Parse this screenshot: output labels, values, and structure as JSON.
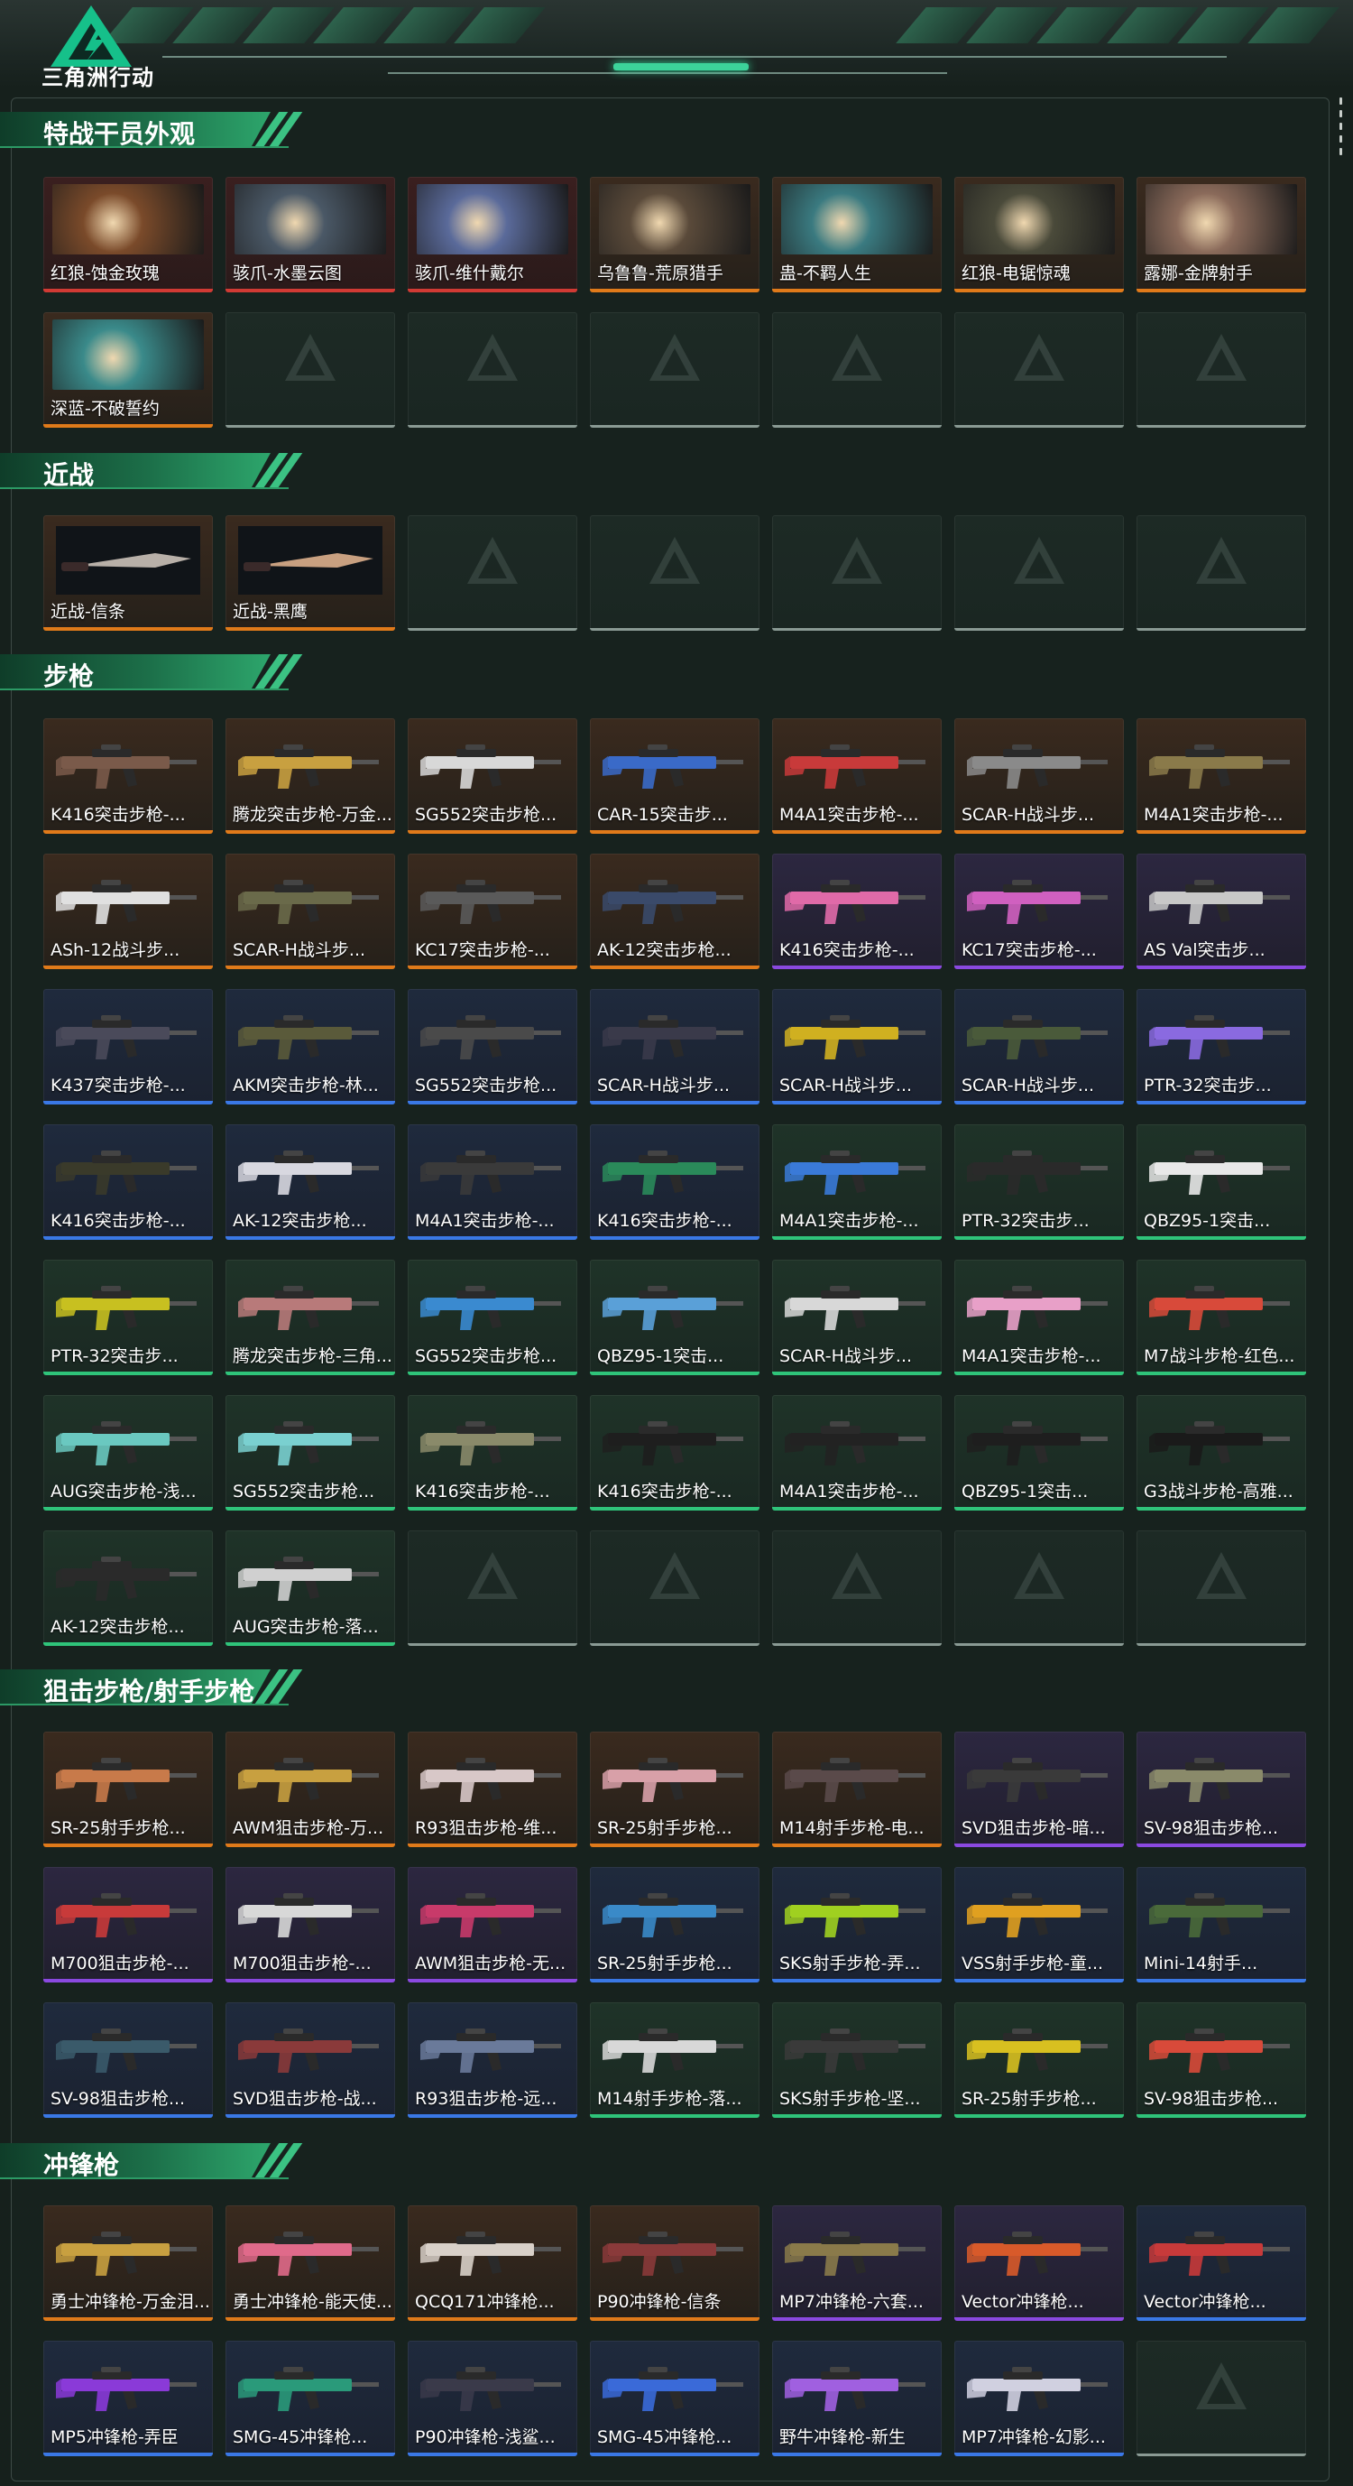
{
  "header": {
    "logo_text": "三角洲行动"
  },
  "colors": {
    "orange": "#e07a1a",
    "purple": "#8a49e0",
    "blue": "#3a78e6",
    "green": "#2fc47a",
    "red": "#d13a34",
    "accent": "#2da66c"
  },
  "sections": [
    {
      "title": "特战干员外观",
      "items": [
        {
          "label": "红狼-蚀金玫瑰",
          "rarity": "red",
          "kind": "portrait",
          "tint": "#7a4a2a"
        },
        {
          "label": "骇爪-水墨云图",
          "rarity": "red",
          "kind": "portrait",
          "tint": "#4a5866"
        },
        {
          "label": "骇爪-维什戴尔",
          "rarity": "red",
          "kind": "portrait",
          "tint": "#5a6a9a"
        },
        {
          "label": "乌鲁鲁-荒原猎手",
          "rarity": "orange",
          "kind": "portrait",
          "tint": "#5a4a3a"
        },
        {
          "label": "蛊-不羁人生",
          "rarity": "orange",
          "kind": "portrait",
          "tint": "#3a7a80"
        },
        {
          "label": "红狼-电锯惊魂",
          "rarity": "orange",
          "kind": "portrait",
          "tint": "#4a4a3a"
        },
        {
          "label": "露娜-金牌射手",
          "rarity": "orange",
          "kind": "portrait",
          "tint": "#8a6a5a"
        },
        {
          "label": "深蓝-不破誓约",
          "rarity": "orange",
          "kind": "portrait",
          "tint": "#3a8a8a"
        },
        {
          "label": "",
          "rarity": "empty"
        },
        {
          "label": "",
          "rarity": "empty"
        },
        {
          "label": "",
          "rarity": "empty"
        },
        {
          "label": "",
          "rarity": "empty"
        },
        {
          "label": "",
          "rarity": "empty"
        },
        {
          "label": "",
          "rarity": "empty"
        }
      ]
    },
    {
      "title": "近战",
      "items": [
        {
          "label": "近战-信条",
          "rarity": "orange",
          "kind": "knife",
          "tint": "#b8b0a8"
        },
        {
          "label": "近战-黑鹰",
          "rarity": "orange",
          "kind": "knife",
          "tint": "#c8a080"
        },
        {
          "label": "",
          "rarity": "empty"
        },
        {
          "label": "",
          "rarity": "empty"
        },
        {
          "label": "",
          "rarity": "empty"
        },
        {
          "label": "",
          "rarity": "empty"
        },
        {
          "label": "",
          "rarity": "empty"
        }
      ]
    },
    {
      "title": "步枪",
      "items": [
        {
          "label": "K416突击步枪-...",
          "rarity": "orange",
          "tint": "#7a5a4a"
        },
        {
          "label": "腾龙突击步枪-万金...",
          "rarity": "orange",
          "tint": "#c8a040"
        },
        {
          "label": "SG552突击步枪...",
          "rarity": "orange",
          "tint": "#d8d8d8"
        },
        {
          "label": "CAR-15突击步...",
          "rarity": "orange",
          "tint": "#3a6ac8"
        },
        {
          "label": "M4A1突击步枪-...",
          "rarity": "orange",
          "tint": "#c83a3a"
        },
        {
          "label": "SCAR-H战斗步...",
          "rarity": "orange",
          "tint": "#8a8a8a"
        },
        {
          "label": "M4A1突击步枪-...",
          "rarity": "orange",
          "tint": "#8a7a4a"
        },
        {
          "label": "ASh-12战斗步...",
          "rarity": "orange",
          "tint": "#e0e0e0"
        },
        {
          "label": "SCAR-H战斗步...",
          "rarity": "orange",
          "tint": "#6a6a4a"
        },
        {
          "label": "KC17突击步枪-...",
          "rarity": "orange",
          "tint": "#5a5a5a"
        },
        {
          "label": "AK-12突击步枪...",
          "rarity": "orange",
          "tint": "#3a4a6a"
        },
        {
          "label": "K416突击步枪-...",
          "rarity": "purple",
          "tint": "#e06aa8"
        },
        {
          "label": "KC17突击步枪-...",
          "rarity": "purple",
          "tint": "#d060c0"
        },
        {
          "label": "AS Val突击步...",
          "rarity": "purple",
          "tint": "#c8c8c8"
        },
        {
          "label": "K437突击步枪-...",
          "rarity": "blue",
          "tint": "#4a4a5a"
        },
        {
          "label": "AKM突击步枪-林...",
          "rarity": "blue",
          "tint": "#5a5a3a"
        },
        {
          "label": "SG552突击步枪...",
          "rarity": "blue",
          "tint": "#4a4a4a"
        },
        {
          "label": "SCAR-H战斗步...",
          "rarity": "blue",
          "tint": "#3a3a4a"
        },
        {
          "label": "SCAR-H战斗步...",
          "rarity": "blue",
          "tint": "#d0b020"
        },
        {
          "label": "SCAR-H战斗步...",
          "rarity": "blue",
          "tint": "#4a5a3a"
        },
        {
          "label": "PTR-32突击步...",
          "rarity": "blue",
          "tint": "#8a6ae0"
        },
        {
          "label": "K416突击步枪-...",
          "rarity": "blue",
          "tint": "#3a3a2a"
        },
        {
          "label": "AK-12突击步枪...",
          "rarity": "blue",
          "tint": "#d8d8e0"
        },
        {
          "label": "M4A1突击步枪-...",
          "rarity": "blue",
          "tint": "#3a3a3a"
        },
        {
          "label": "K416突击步枪-...",
          "rarity": "blue",
          "tint": "#2a8a5a"
        },
        {
          "label": "M4A1突击步枪-...",
          "rarity": "green",
          "tint": "#3a7ad8"
        },
        {
          "label": "PTR-32突击步...",
          "rarity": "green",
          "tint": "#2a2a2a"
        },
        {
          "label": "QBZ95-1突击...",
          "rarity": "green",
          "tint": "#e8e8e8"
        },
        {
          "label": "PTR-32突击步...",
          "rarity": "green",
          "tint": "#c8c020"
        },
        {
          "label": "腾龙突击步枪-三角...",
          "rarity": "green",
          "tint": "#b87a7a"
        },
        {
          "label": "SG552突击步枪...",
          "rarity": "green",
          "tint": "#3a8ad0"
        },
        {
          "label": "QBZ95-1突击...",
          "rarity": "green",
          "tint": "#5aa0d8"
        },
        {
          "label": "SCAR-H战斗步...",
          "rarity": "green",
          "tint": "#d8d8d8"
        },
        {
          "label": "M4A1突击步枪-...",
          "rarity": "green",
          "tint": "#e8a0c8"
        },
        {
          "label": "M7战斗步枪-红色...",
          "rarity": "green",
          "tint": "#d84a3a"
        },
        {
          "label": "AUG突击步枪-浅...",
          "rarity": "green",
          "tint": "#6ac8c0"
        },
        {
          "label": "SG552突击步枪...",
          "rarity": "green",
          "tint": "#7ad0d0"
        },
        {
          "label": "K416突击步枪-...",
          "rarity": "green",
          "tint": "#8a8a6a"
        },
        {
          "label": "K416突击步枪-...",
          "rarity": "green",
          "tint": "#1e1e1e"
        },
        {
          "label": "M4A1突击步枪-...",
          "rarity": "green",
          "tint": "#222222"
        },
        {
          "label": "QBZ95-1突击...",
          "rarity": "green",
          "tint": "#1e1e1e"
        },
        {
          "label": "G3战斗步枪-高雅...",
          "rarity": "green",
          "tint": "#1a1a1a"
        },
        {
          "label": "AK-12突击步枪...",
          "rarity": "green",
          "tint": "#2a2a2a"
        },
        {
          "label": "AUG突击步枪-落...",
          "rarity": "green",
          "tint": "#d0d0d0"
        },
        {
          "label": "",
          "rarity": "empty"
        },
        {
          "label": "",
          "rarity": "empty"
        },
        {
          "label": "",
          "rarity": "empty"
        },
        {
          "label": "",
          "rarity": "empty"
        },
        {
          "label": "",
          "rarity": "empty"
        }
      ]
    },
    {
      "title": "狙击步枪/射手步枪",
      "items": [
        {
          "label": "SR-25射手步枪...",
          "rarity": "orange",
          "tint": "#c87a4a"
        },
        {
          "label": "AWM狙击步枪-万...",
          "rarity": "orange",
          "tint": "#c8a040"
        },
        {
          "label": "R93狙击步枪-维...",
          "rarity": "orange",
          "tint": "#d8c8c8"
        },
        {
          "label": "SR-25射手步枪...",
          "rarity": "orange",
          "tint": "#d8a0a8"
        },
        {
          "label": "M14射手步枪-电...",
          "rarity": "orange",
          "tint": "#5a4a4a"
        },
        {
          "label": "SVD狙击步枪-暗...",
          "rarity": "purple",
          "tint": "#3a3a3a"
        },
        {
          "label": "SV-98狙击步枪...",
          "rarity": "purple",
          "tint": "#8a8a6a"
        },
        {
          "label": "M700狙击步枪-...",
          "rarity": "purple",
          "tint": "#c83a3a"
        },
        {
          "label": "M700狙击步枪-...",
          "rarity": "purple",
          "tint": "#d8d8d8"
        },
        {
          "label": "AWM狙击步枪-无...",
          "rarity": "purple",
          "tint": "#c83a6a"
        },
        {
          "label": "SR-25射手步枪...",
          "rarity": "blue",
          "tint": "#3a8ac8"
        },
        {
          "label": "SKS射手步枪-弄...",
          "rarity": "blue",
          "tint": "#a0d020"
        },
        {
          "label": "VSS射手步枪-童...",
          "rarity": "blue",
          "tint": "#e0a020"
        },
        {
          "label": "Mini-14射手...",
          "rarity": "blue",
          "tint": "#4a6a3a"
        },
        {
          "label": "SV-98狙击步枪...",
          "rarity": "blue",
          "tint": "#3a5a6a"
        },
        {
          "label": "SVD狙击步枪-战...",
          "rarity": "blue",
          "tint": "#8a3a3a"
        },
        {
          "label": "R93狙击步枪-远...",
          "rarity": "blue",
          "tint": "#6a7a9a"
        },
        {
          "label": "M14射手步枪-落...",
          "rarity": "green",
          "tint": "#d8d8d8"
        },
        {
          "label": "SKS射手步枪-坚...",
          "rarity": "green",
          "tint": "#3a3a3a"
        },
        {
          "label": "SR-25射手步枪...",
          "rarity": "green",
          "tint": "#d8c020"
        },
        {
          "label": "SV-98狙击步枪...",
          "rarity": "green",
          "tint": "#d84a3a"
        }
      ]
    },
    {
      "title": "冲锋枪",
      "items": [
        {
          "label": "勇士冲锋枪-万金泪...",
          "rarity": "orange",
          "tint": "#c8a040"
        },
        {
          "label": "勇士冲锋枪-能天使...",
          "rarity": "orange",
          "tint": "#e06a8a"
        },
        {
          "label": "QCQ171冲锋枪...",
          "rarity": "orange",
          "tint": "#d8d0c8"
        },
        {
          "label": "P90冲锋枪-信条",
          "rarity": "orange",
          "tint": "#8a3a3a"
        },
        {
          "label": "MP7冲锋枪-六套...",
          "rarity": "purple",
          "tint": "#8a7a4a"
        },
        {
          "label": "Vector冲锋枪...",
          "rarity": "purple",
          "tint": "#d85a2a"
        },
        {
          "label": "Vector冲锋枪...",
          "rarity": "blue",
          "tint": "#c83a3a"
        },
        {
          "label": "MP5冲锋枪-弄臣",
          "rarity": "blue",
          "tint": "#8a3ad8"
        },
        {
          "label": "SMG-45冲锋枪...",
          "rarity": "blue",
          "tint": "#2a9a7a"
        },
        {
          "label": "P90冲锋枪-浅鲨...",
          "rarity": "blue",
          "tint": "#3a3a4a"
        },
        {
          "label": "SMG-45冲锋枪...",
          "rarity": "blue",
          "tint": "#3a6ad8"
        },
        {
          "label": "野牛冲锋枪-新生",
          "rarity": "blue",
          "tint": "#a060e0"
        },
        {
          "label": "MP7冲锋枪-幻影...",
          "rarity": "blue",
          "tint": "#d0d0e0"
        },
        {
          "label": "",
          "rarity": "empty"
        }
      ]
    }
  ]
}
